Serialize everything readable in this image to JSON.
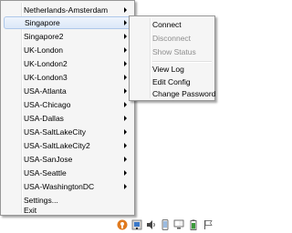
{
  "main_menu": {
    "items": [
      {
        "label": "Netherlands-Amsterdam",
        "submenu": true
      },
      {
        "label": "Singapore",
        "submenu": true,
        "highlighted": true
      },
      {
        "label": "Singapore2",
        "submenu": true
      },
      {
        "label": "UK-London",
        "submenu": true
      },
      {
        "label": "UK-London2",
        "submenu": true
      },
      {
        "label": "UK-London3",
        "submenu": true
      },
      {
        "label": "USA-Atlanta",
        "submenu": true
      },
      {
        "label": "USA-Chicago",
        "submenu": true
      },
      {
        "label": "USA-Dallas",
        "submenu": true
      },
      {
        "label": "USA-SaltLakeCity",
        "submenu": true
      },
      {
        "label": "USA-SaltLakeCity2",
        "submenu": true
      },
      {
        "label": "USA-SanJose",
        "submenu": true
      },
      {
        "label": "USA-Seattle",
        "submenu": true
      },
      {
        "label": "USA-WashingtonDC",
        "submenu": true
      },
      {
        "label": "Settings..."
      },
      {
        "label": "Exit"
      }
    ]
  },
  "sub_menu": {
    "items": [
      {
        "label": "Connect",
        "enabled": true
      },
      {
        "label": "Disconnect",
        "enabled": false
      },
      {
        "label": "Show Status",
        "enabled": false
      },
      {
        "label": "View Log",
        "enabled": true
      },
      {
        "label": "Edit Config",
        "enabled": true
      },
      {
        "label": "Change Password",
        "enabled": true
      }
    ]
  },
  "taskbar": {
    "icons": [
      "openvpn-icon",
      "network-icon",
      "volume-icon",
      "tablet-icon",
      "display-icon",
      "battery-icon",
      "flag-icon"
    ]
  },
  "colors": {
    "menu_bg": "#f5f5f5",
    "highlight": "#dbe8f8",
    "disabled_text": "#8d8d8d"
  }
}
